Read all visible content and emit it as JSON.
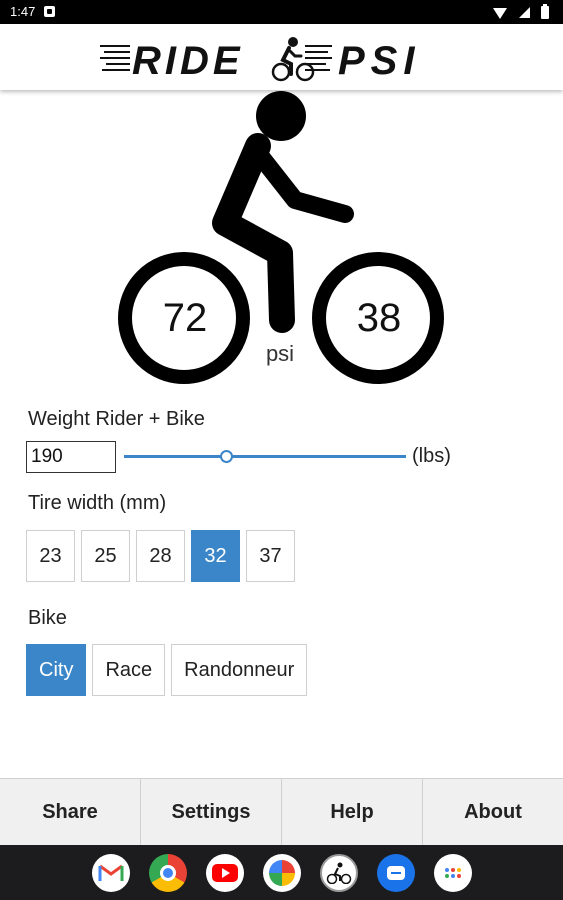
{
  "status_bar": {
    "time": "1:47"
  },
  "app": {
    "logo_text_left": "RIDE",
    "logo_text_right": "PSI"
  },
  "pressure": {
    "front": "72",
    "rear": "38",
    "unit": "psi"
  },
  "weight": {
    "label": "Weight Rider + Bike",
    "value": "190",
    "unit": "(lbs)",
    "slider_fraction": 0.36
  },
  "tire": {
    "label": "Tire width (mm)",
    "options": [
      "23",
      "25",
      "28",
      "32",
      "37"
    ],
    "selected": "32"
  },
  "bike": {
    "label": "Bike",
    "options": [
      "City",
      "Race",
      "Randonneur"
    ],
    "selected": "City"
  },
  "bottom_nav": {
    "share": "Share",
    "settings": "Settings",
    "help": "Help",
    "about": "About"
  },
  "dock": [
    "gmail-icon",
    "chrome-icon",
    "youtube-icon",
    "photos-icon",
    "ridepsi-icon",
    "messages-icon",
    "app-drawer-icon"
  ],
  "colors": {
    "accent": "#3a86c8",
    "status_bar": "#000000",
    "dock": "#1c1c1e",
    "nav_bg": "#f0f0f0"
  }
}
